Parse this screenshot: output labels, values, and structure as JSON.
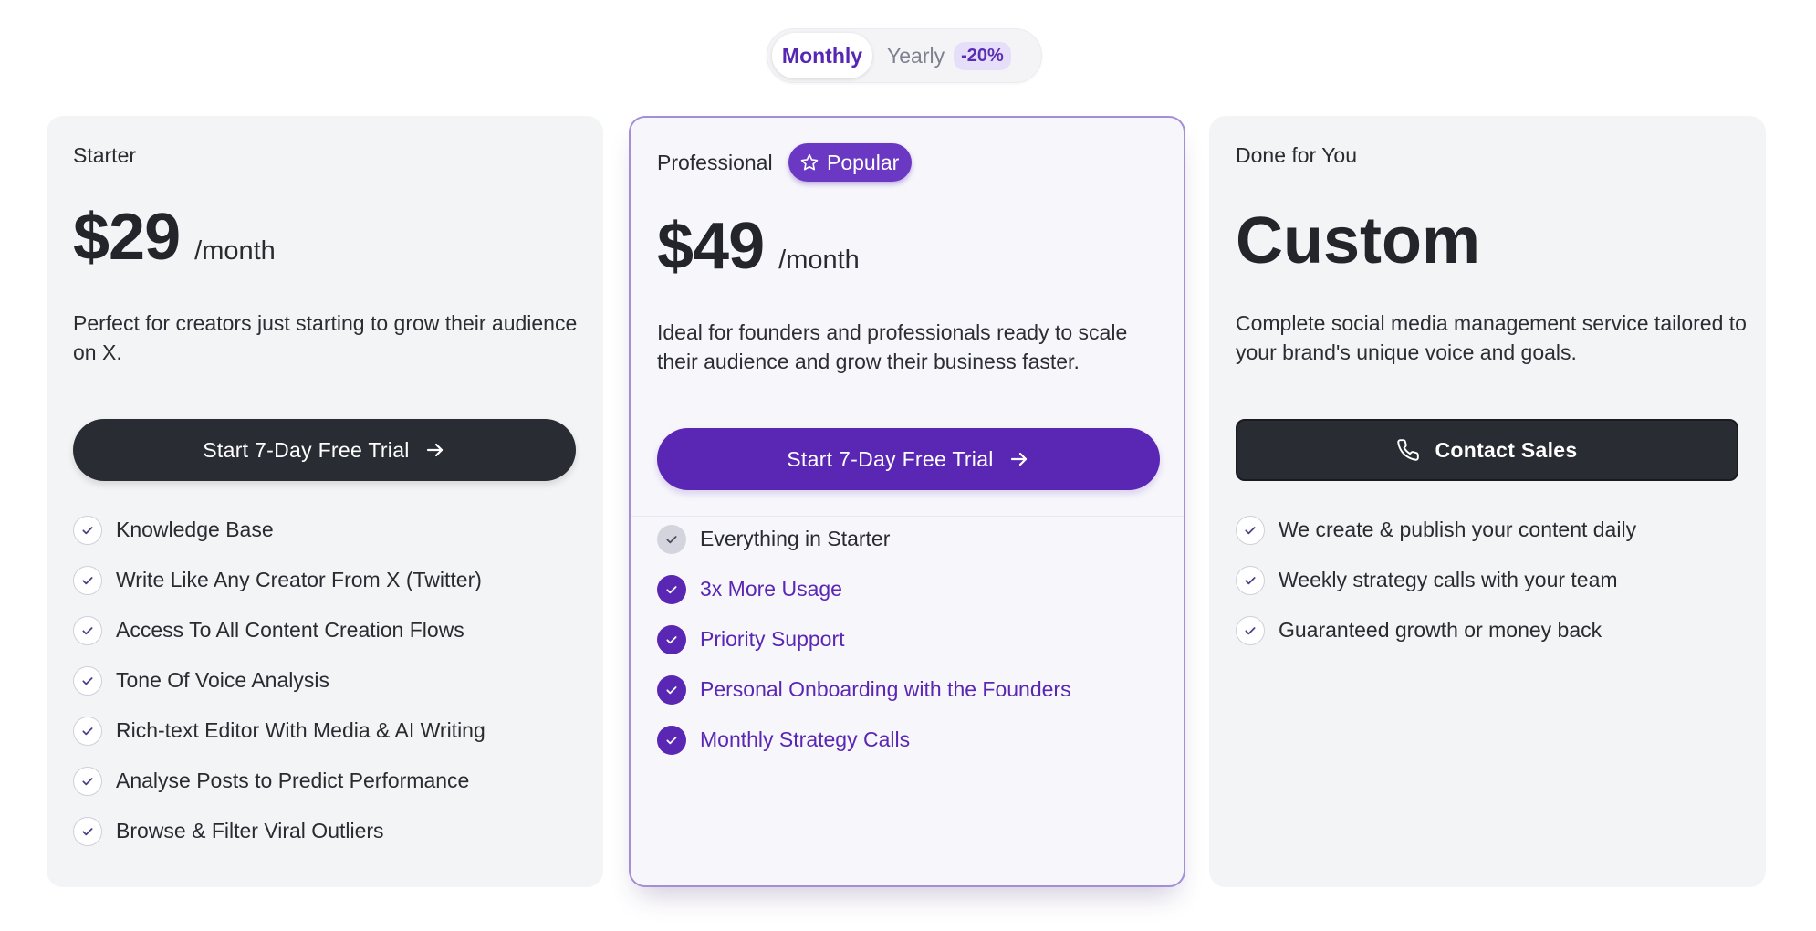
{
  "billing_toggle": {
    "monthly_label": "Monthly",
    "yearly_label": "Yearly",
    "discount_label": "-20%",
    "selected": "Monthly"
  },
  "plans": {
    "starter": {
      "name": "Starter",
      "price": "$29",
      "period": "/month",
      "description": "Perfect for creators just starting to grow their audience on X.",
      "cta_label": "Start 7-Day Free Trial",
      "features": [
        "Knowledge Base",
        "Write Like Any Creator From X (Twitter)",
        "Access To All Content Creation Flows",
        "Tone Of Voice Analysis",
        "Rich-text Editor With Media & AI Writing",
        "Analyse Posts to Predict Performance",
        "Browse & Filter Viral Outliers"
      ]
    },
    "professional": {
      "name": "Professional",
      "badge": "Popular",
      "price": "$49",
      "period": "/month",
      "description": "Ideal for founders and professionals ready to scale their audience and grow their business faster.",
      "cta_label": "Start 7-Day Free Trial",
      "features": [
        "Everything in Starter",
        "3x More Usage",
        "Priority Support",
        "Personal Onboarding with the Founders",
        "Monthly Strategy Calls"
      ]
    },
    "done_for_you": {
      "name": "Done for You",
      "price": "Custom",
      "description": "Complete social media management service tailored to your brand's unique voice and goals.",
      "cta_label": "Contact Sales",
      "features": [
        "We create & publish your content daily",
        "Weekly strategy calls with your team",
        "Guaranteed growth or money back"
      ]
    }
  },
  "colors": {
    "accent": "#5a26b4",
    "dark_button": "#2a2c34",
    "card_bg": "#f3f4f6",
    "popular_border": "#a58ed8"
  },
  "icons": {
    "cta_arrow": "arrow-right-icon",
    "check": "check-icon",
    "badge": "star-icon",
    "contact": "phone-icon"
  }
}
